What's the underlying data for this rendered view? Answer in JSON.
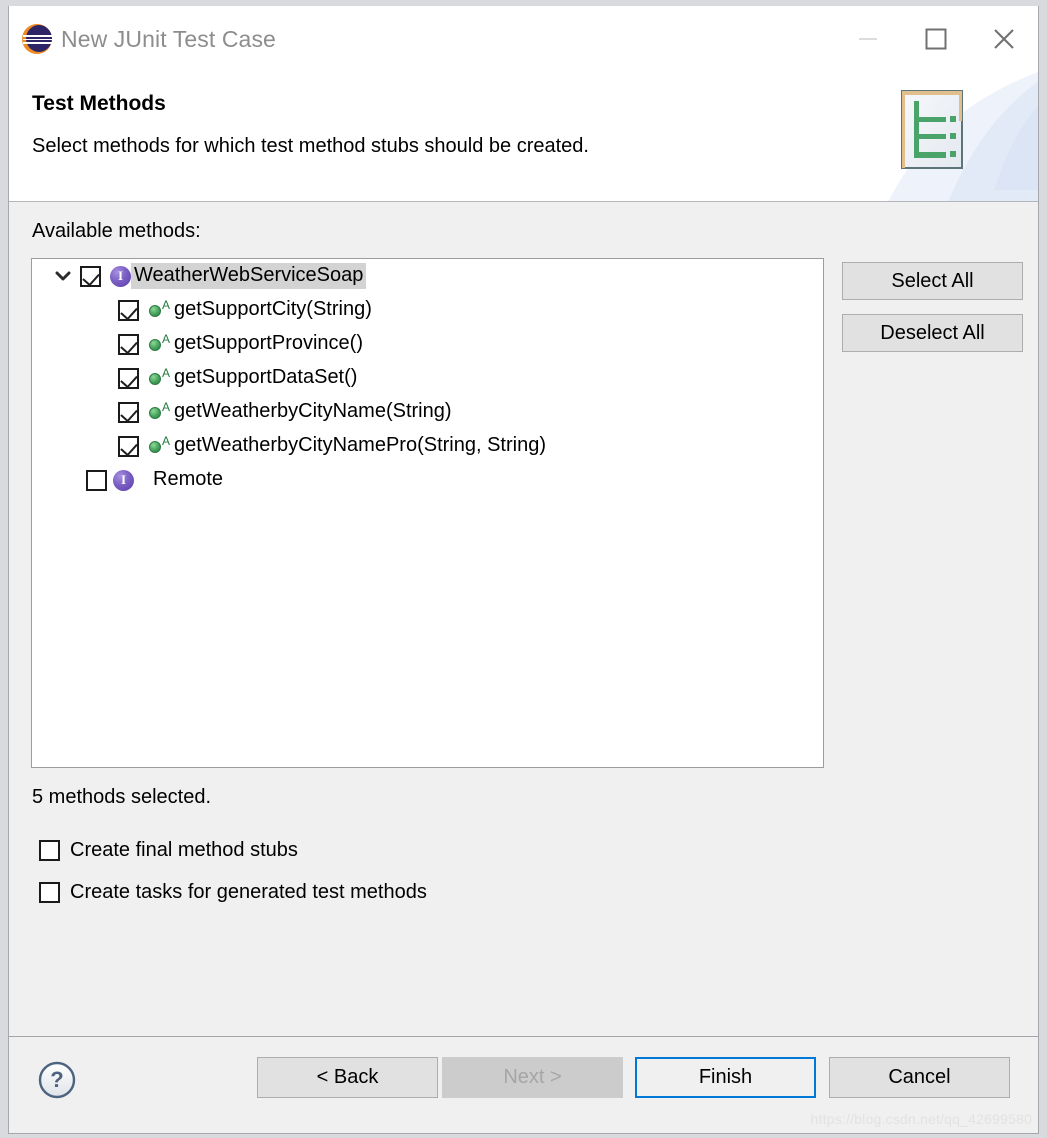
{
  "window": {
    "title": "New JUnit Test Case",
    "app_icon": "eclipse-icon",
    "controls": {
      "minimize": "minimize-icon",
      "maximize": "maximize-icon",
      "close": "close-icon"
    }
  },
  "header": {
    "title": "Test Methods",
    "description": "Select methods for which test method stubs should be created.",
    "banner_icon": "junit-wizard-banner-icon"
  },
  "main": {
    "available_label": "Available methods:",
    "tree": [
      {
        "label": "WeatherWebServiceSoap",
        "level": 0,
        "checked": true,
        "selected": true,
        "expanded": true,
        "icon": "interface-icon",
        "twisty": "chevron-down-icon"
      },
      {
        "label": "getSupportCity(String)",
        "level": 1,
        "checked": true,
        "selected": false,
        "icon": "abstract-method-icon"
      },
      {
        "label": "getSupportProvince()",
        "level": 1,
        "checked": true,
        "selected": false,
        "icon": "abstract-method-icon"
      },
      {
        "label": "getSupportDataSet()",
        "level": 1,
        "checked": true,
        "selected": false,
        "icon": "abstract-method-icon"
      },
      {
        "label": "getWeatherbyCityName(String)",
        "level": 1,
        "checked": true,
        "selected": false,
        "icon": "abstract-method-icon"
      },
      {
        "label": "getWeatherbyCityNamePro(String, String)",
        "level": 1,
        "checked": true,
        "selected": false,
        "icon": "abstract-method-icon"
      },
      {
        "label": "Remote",
        "level": 0,
        "checked": false,
        "selected": false,
        "icon": "interface-icon",
        "twisty": ""
      }
    ],
    "select_all_label": "Select All",
    "deselect_all_label": "Deselect All",
    "methods_selected": "5 methods selected.",
    "options": [
      {
        "label": "Create final method stubs",
        "checked": false
      },
      {
        "label": "Create tasks for generated test methods",
        "checked": false
      }
    ]
  },
  "footer": {
    "help_icon": "help-icon",
    "back_label": "< Back",
    "next_label": "Next >",
    "next_enabled": false,
    "finish_label": "Finish",
    "cancel_label": "Cancel",
    "watermark": "https://blog.csdn.net/qq_42699580"
  },
  "colors": {
    "accent": "#0078d7",
    "interface_icon": "#5b3ea8",
    "method_icon": "#2d7c44",
    "banner_green": "#4aa368",
    "eclipse_orange": "#f08a24",
    "eclipse_navy": "#2e2566"
  }
}
